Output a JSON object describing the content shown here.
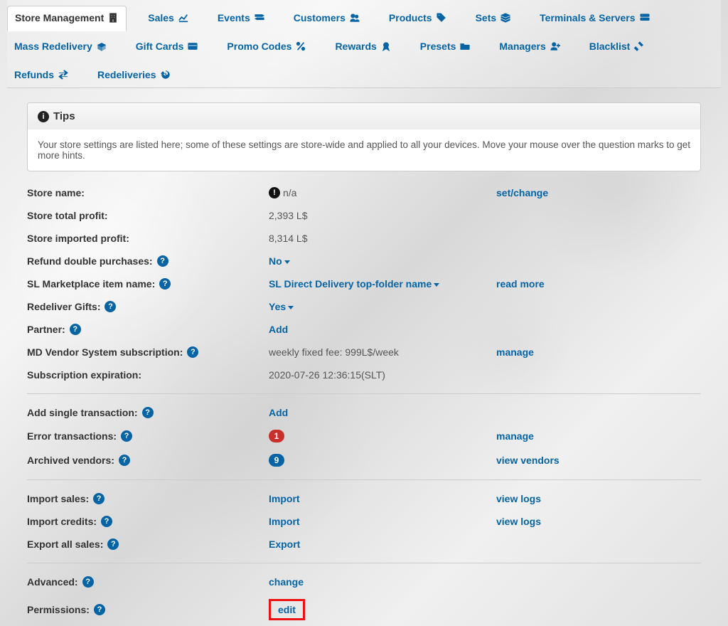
{
  "nav": [
    {
      "label": "Store Management",
      "icon": "building-icon",
      "active": true
    },
    {
      "label": "Sales",
      "icon": "chart-line-icon"
    },
    {
      "label": "Events",
      "icon": "signpost-icon"
    },
    {
      "label": "Customers",
      "icon": "users-icon"
    },
    {
      "label": "Products",
      "icon": "tags-icon"
    },
    {
      "label": "Sets",
      "icon": "stack-icon"
    },
    {
      "label": "Terminals & Servers",
      "icon": "server-icon"
    },
    {
      "label": "Mass Redelivery",
      "icon": "box-open-icon"
    },
    {
      "label": "Gift Cards",
      "icon": "credit-card-icon"
    },
    {
      "label": "Promo Codes",
      "icon": "percent-icon"
    },
    {
      "label": "Rewards",
      "icon": "medal-icon"
    },
    {
      "label": "Presets",
      "icon": "folder-open-icon"
    },
    {
      "label": "Managers",
      "icon": "user-plus-icon"
    },
    {
      "label": "Blacklist",
      "icon": "hammer-icon"
    },
    {
      "label": "Refunds",
      "icon": "exchange-icon"
    },
    {
      "label": "Redeliveries",
      "icon": "history-icon"
    }
  ],
  "tips": {
    "header": "Tips",
    "body": "Your store settings are listed here; some of these settings are store-wide and applied to all your devices. Move your mouse over the question marks to get more hints."
  },
  "sections": [
    [
      {
        "label": "Store name:",
        "help": false,
        "valueType": "excl-text",
        "value": "n/a",
        "action": "set/change"
      },
      {
        "label": "Store total profit:",
        "help": false,
        "valueType": "text",
        "value": "2,393 L$"
      },
      {
        "label": "Store imported profit:",
        "help": false,
        "valueType": "text",
        "value": "8,314 L$"
      },
      {
        "label": "Refund double purchases:",
        "help": true,
        "valueType": "dropdown-link",
        "value": "No"
      },
      {
        "label": "SL Marketplace item name:",
        "help": true,
        "valueType": "dropdown-link",
        "value": "SL Direct Delivery top-folder name",
        "action": "read more"
      },
      {
        "label": "Redeliver Gifts:",
        "help": true,
        "valueType": "dropdown-link",
        "value": "Yes"
      },
      {
        "label": "Partner:",
        "help": true,
        "valueType": "link",
        "value": "Add"
      },
      {
        "label": "MD Vendor System subscription:",
        "help": true,
        "valueType": "text",
        "value": "weekly fixed fee: 999L$/week",
        "action": "manage"
      },
      {
        "label": "Subscription expiration:",
        "help": false,
        "valueType": "text",
        "value": "2020-07-26 12:36:15(SLT)"
      }
    ],
    [
      {
        "label": "Add single transaction:",
        "help": true,
        "valueType": "link",
        "value": "Add"
      },
      {
        "label": "Error transactions:",
        "help": true,
        "valueType": "badge-red",
        "value": "1",
        "action": "manage"
      },
      {
        "label": "Archived vendors:",
        "help": true,
        "valueType": "badge-blue",
        "value": "9",
        "action": "view vendors"
      }
    ],
    [
      {
        "label": "Import sales:",
        "help": true,
        "valueType": "link",
        "value": "Import",
        "action": "view logs"
      },
      {
        "label": "Import credits:",
        "help": true,
        "valueType": "link",
        "value": "Import",
        "action": "view logs"
      },
      {
        "label": "Export all sales:",
        "help": true,
        "valueType": "link",
        "value": "Export"
      }
    ],
    [
      {
        "label": "Advanced:",
        "help": true,
        "valueType": "link",
        "value": "change"
      },
      {
        "label": "Permissions:",
        "help": true,
        "valueType": "link-highlight",
        "value": "edit"
      }
    ]
  ]
}
